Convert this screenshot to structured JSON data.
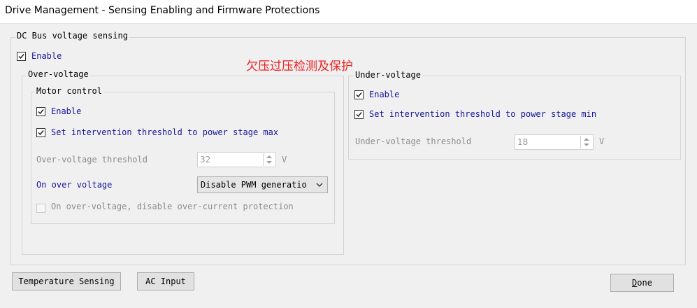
{
  "window": {
    "title": "Drive Management - Sensing Enabling and Firmware Protections"
  },
  "dc_bus": {
    "legend": "DC Bus voltage sensing",
    "enable_label": "Enable",
    "enable_checked": true
  },
  "annotation": "欠压过压检测及保护",
  "over_voltage": {
    "legend": "Over-voltage",
    "motor_control": {
      "legend": "Motor control",
      "enable_label": "Enable",
      "set_threshold_label": "Set intervention threshold to power stage max",
      "threshold_label": "Over-voltage threshold",
      "threshold_value": "32",
      "unit": "V",
      "on_over_voltage_label": "On over voltage",
      "on_over_voltage_value": "Disable PWM generatio",
      "disable_ocp_label": "On over-voltage, disable over-current protection"
    }
  },
  "under_voltage": {
    "legend": "Under-voltage",
    "enable_label": "Enable",
    "set_threshold_label": "Set intervention threshold to power stage min",
    "threshold_label": "Under-voltage threshold",
    "threshold_value": "18",
    "unit": "V"
  },
  "buttons": {
    "temperature": "Temperature Sensing",
    "ac_input": "AC Input",
    "done_mnemonic": "D",
    "done_rest": "one"
  },
  "colors": {
    "label_blue": "#16169c",
    "disabled_gray": "#8c8c8c",
    "annotation_red": "#ee2020",
    "frame": "#d5d5d5"
  }
}
